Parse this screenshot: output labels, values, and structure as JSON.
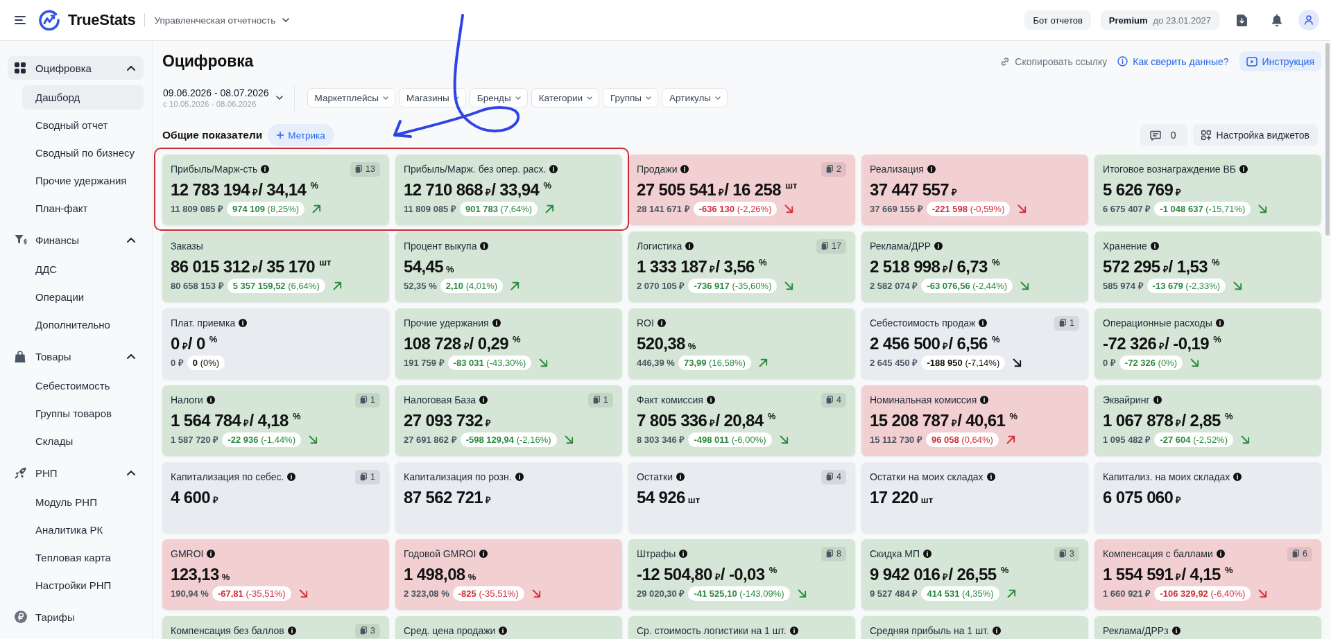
{
  "header": {
    "brand": "TrueStats",
    "workspace": "Управленческая отчетность",
    "bot_button": "Бот отчетов",
    "plan": {
      "name": "Premium",
      "until": "до 23.01.2027"
    }
  },
  "sidebar": {
    "items": [
      {
        "kind": "group",
        "label": "Оцифровка",
        "selected": true,
        "expanded": true,
        "children": [
          {
            "label": "Дашборд",
            "selected": true
          },
          {
            "label": "Сводный отчет",
            "selected": false
          },
          {
            "label": "Сводный по бизнесу",
            "selected": false
          },
          {
            "label": "Прочие удержания",
            "selected": false
          },
          {
            "label": "План-факт",
            "selected": false
          }
        ]
      },
      {
        "kind": "group",
        "label": "Финансы",
        "selected": false,
        "expanded": true,
        "children": [
          {
            "label": "ДДС",
            "selected": false
          },
          {
            "label": "Операции",
            "selected": false
          },
          {
            "label": "Дополнительно",
            "selected": false
          }
        ]
      },
      {
        "kind": "group",
        "label": "Товары",
        "selected": false,
        "expanded": true,
        "children": [
          {
            "label": "Себестоимость",
            "selected": false
          },
          {
            "label": "Группы товаров",
            "selected": false
          },
          {
            "label": "Склады",
            "selected": false
          }
        ]
      },
      {
        "kind": "group",
        "label": "РНП",
        "selected": false,
        "expanded": true,
        "children": [
          {
            "label": "Модуль РНП",
            "selected": false
          },
          {
            "label": "Аналитика РК",
            "selected": false
          },
          {
            "label": "Тепловая карта",
            "selected": false
          },
          {
            "label": "Настройки РНП",
            "selected": false
          }
        ]
      },
      {
        "kind": "link",
        "label": "Тарифы",
        "selected": false
      }
    ]
  },
  "page": {
    "title": "Оцифровка",
    "actions": [
      {
        "kind": "link",
        "label": "Скопировать ссылку"
      },
      {
        "kind": "help",
        "label": "Как сверить данные?"
      },
      {
        "kind": "video",
        "label": "Инструкция"
      }
    ]
  },
  "period": {
    "range": "09.06.2026 - 08.07.2026",
    "compare": "с 10.05.2026 - 08.06.2026"
  },
  "filters": [
    {
      "label": "Маркетплейсы"
    },
    {
      "label": "Магазины"
    },
    {
      "label": "Бренды"
    },
    {
      "label": "Категории"
    },
    {
      "label": "Группы"
    },
    {
      "label": "Артикулы"
    }
  ],
  "section": {
    "title": "Общие показатели",
    "add_button": "Метрика",
    "comments": "0",
    "settings_button": "Настройка виджетов"
  },
  "cards": [
    {
      "kind": "positive",
      "title": "Прибыль/Марж-сть",
      "info": true,
      "badge": "13",
      "amount": "12 783 194",
      "amount_unit": "₽",
      "ratio": "/ 34,14 $^{%}$",
      "previous": "11 809 085 ₽",
      "change": {
        "kind": "up",
        "text": "**974 109** (8,25%)"
      }
    },
    {
      "kind": "positive",
      "title": "Прибыль/Марж. без опер. расх.",
      "info": true,
      "amount": "12 710 868",
      "amount_unit": "₽",
      "ratio": "/ 33,94 $^{%}$",
      "previous": "11 809 085 ₽",
      "change": {
        "kind": "up",
        "text": "**901 783** (7,64%)"
      }
    },
    {
      "kind": "negative",
      "title": "Продажи",
      "info": true,
      "badge": "2",
      "amount": "27 505 541",
      "amount_unit": "₽",
      "ratio": "/ 16 258 $^{шт}$",
      "previous": "28 141 671 ₽",
      "change": {
        "kind": "down",
        "text": "**-636 130** (-2,26%)"
      }
    },
    {
      "kind": "negative",
      "title": "Реализация",
      "info": true,
      "amount": "37 447 557",
      "amount_unit": "₽",
      "previous": "37 669 155 ₽",
      "change": {
        "kind": "down",
        "text": "**-221 598** (-0,59%)"
      }
    },
    {
      "kind": "positive",
      "title": "Итоговое вознаграждение ВБ",
      "info": true,
      "amount": "5 626 769",
      "amount_unit": "₽",
      "previous": "6 675 407 ₽",
      "change": {
        "kind": "down",
        "text": "**-1 048 637** (-15,71%)"
      }
    },
    {
      "kind": "positive",
      "title": "Заказы",
      "info": false,
      "amount": "86 015 312",
      "amount_unit": "₽",
      "ratio": "/ 35 170 $^{шт}$",
      "previous": "80 658 153 ₽",
      "change": {
        "kind": "up",
        "text": "**5 357 159,52** (6,64%)"
      }
    },
    {
      "kind": "positive",
      "title": "Процент выкупа",
      "info": true,
      "amount": "54,45",
      "amount_unit": "%",
      "previous": "52,35 %",
      "change": {
        "kind": "up",
        "text": "**2,10** (4,01%)"
      }
    },
    {
      "kind": "positive",
      "title": "Логистика",
      "info": true,
      "badge": "17",
      "amount": "1 333 187",
      "amount_unit": "₽",
      "ratio": "/ 3,56 $^{%}$",
      "previous": "2 070 105 ₽",
      "change": {
        "kind": "down",
        "text": "**-736 917** (-35,60%)"
      }
    },
    {
      "kind": "positive",
      "title": "Реклама/ДРР",
      "info": true,
      "amount": "2 518 998",
      "amount_unit": "₽",
      "ratio": "/ 6,73 $^{%}$",
      "previous": "2 582 074 ₽",
      "change": {
        "kind": "down",
        "text": "**-63 076,56** (-2,44%)"
      }
    },
    {
      "kind": "positive",
      "title": "Хранение",
      "info": true,
      "amount": "572 295",
      "amount_unit": "₽",
      "ratio": "/ 1,53 $^{%}$",
      "previous": "585 974 ₽",
      "change": {
        "kind": "down",
        "text": "**-13 679** (-2,33%)"
      }
    },
    {
      "kind": "neutral",
      "title": "Плат. приемка",
      "info": true,
      "amount": "0",
      "amount_unit": "₽",
      "ratio": "/ 0 $^{%}$",
      "previous": "0 ₽",
      "change": {
        "kind": "flat",
        "text": "**0** (0%)"
      }
    },
    {
      "kind": "positive",
      "title": "Прочие удержания",
      "info": true,
      "amount": "108 728",
      "amount_unit": "₽",
      "ratio": "/ 0,29 $^{%}$",
      "previous": "191 759 ₽",
      "change": {
        "kind": "down",
        "text": "**-83 031** (-43,30%)"
      }
    },
    {
      "kind": "positive",
      "title": "ROI",
      "info": true,
      "amount": "520,38",
      "amount_unit": "%",
      "previous": "446,39 %",
      "change": {
        "kind": "up",
        "text": "**73,99** (16,58%)"
      }
    },
    {
      "kind": "neutral",
      "title": "Себестоимость продаж",
      "info": true,
      "badge": "1",
      "amount": "2 456 500",
      "amount_unit": "₽",
      "ratio": "/ 6,56 $^{%}$",
      "previous": "2 645 450 ₽",
      "change": {
        "kind": "down",
        "text": "**-188 950** (-7,14%)"
      }
    },
    {
      "kind": "positive",
      "title": "Операционные расходы",
      "info": true,
      "amount": "-72 326",
      "amount_unit": "₽",
      "ratio": "/ -0,19 $^{%}$",
      "previous": "0 ₽",
      "change": {
        "kind": "down",
        "text": "**-72 326** (0%)"
      }
    },
    {
      "kind": "positive",
      "title": "Налоги",
      "info": true,
      "badge": "1",
      "amount": "1 564 784",
      "amount_unit": "₽",
      "ratio": "/ 4,18 $^{%}$",
      "previous": "1 587 720 ₽",
      "change": {
        "kind": "down",
        "text": "**-22 936** (-1,44%)"
      }
    },
    {
      "kind": "positive",
      "title": "Налоговая База",
      "info": true,
      "badge": "1",
      "amount": "27 093 732",
      "amount_unit": "₽",
      "previous": "27 691 862 ₽",
      "change": {
        "kind": "down",
        "text": "**-598 129,94** (-2,16%)"
      }
    },
    {
      "kind": "positive",
      "title": "Факт комиссия",
      "info": true,
      "badge": "4",
      "amount": "7 805 336",
      "amount_unit": "₽",
      "ratio": "/ 20,84 $^{%}$",
      "previous": "8 303 346 ₽",
      "change": {
        "kind": "down",
        "text": "**-498 011** (-6,00%)"
      }
    },
    {
      "kind": "negative",
      "title": "Номинальная комиссия",
      "info": true,
      "amount": "15 208 787",
      "amount_unit": "₽",
      "ratio": "/ 40,61 $^{%}$",
      "previous": "15 112 730 ₽",
      "change": {
        "kind": "up",
        "text": "**96 058** (0,64%)"
      }
    },
    {
      "kind": "positive",
      "title": "Эквайринг",
      "info": true,
      "amount": "1 067 878",
      "amount_unit": "₽",
      "ratio": "/ 2,85 $^{%}$",
      "previous": "1 095 482 ₽",
      "change": {
        "kind": "down",
        "text": "**-27 604** (-2,52%)"
      }
    },
    {
      "kind": "neutral",
      "title": "Капитализация по себес.",
      "info": true,
      "badge": "1",
      "amount": "4 600",
      "amount_unit": "₽"
    },
    {
      "kind": "neutral",
      "title": "Капитализация по розн.",
      "info": true,
      "amount": "87 562 721",
      "amount_unit": "₽"
    },
    {
      "kind": "neutral",
      "title": "Остатки",
      "info": true,
      "badge": "4",
      "amount": "54 926",
      "amount_unit": "шт"
    },
    {
      "kind": "neutral",
      "title": "Остатки на моих складах",
      "info": true,
      "amount": "17 220",
      "amount_unit": "шт"
    },
    {
      "kind": "neutral",
      "title": "Капитализ. на моих складах",
      "info": true,
      "amount": "6 075 060",
      "amount_unit": "₽"
    },
    {
      "kind": "negative",
      "title": "GMROI",
      "info": true,
      "amount": "123,13",
      "amount_unit": "%",
      "previous": "190,94 %",
      "change": {
        "kind": "down",
        "text": "**-67,81** (-35,51%)"
      }
    },
    {
      "kind": "negative",
      "title": "Годовой GMROI",
      "info": true,
      "amount": "1 498,08",
      "amount_unit": "%",
      "previous": "2 323,08 %",
      "change": {
        "kind": "down",
        "text": "**-825** (-35,51%)"
      }
    },
    {
      "kind": "positive",
      "title": "Штрафы",
      "info": true,
      "badge": "8",
      "amount": "-12 504,80",
      "amount_unit": "₽",
      "ratio": "/ -0,03 $^{%}$",
      "previous": "29 020,30 ₽",
      "change": {
        "kind": "down",
        "text": "**-41 525,10** (-143,09%)"
      }
    },
    {
      "kind": "positive",
      "title": "Скидка МП",
      "info": true,
      "badge": "3",
      "amount": "9 942 016",
      "amount_unit": "₽",
      "ratio": "/ 26,55 $^{%}$",
      "previous": "9 527 484 ₽",
      "change": {
        "kind": "up",
        "text": "**414 531** (4,35%)"
      }
    },
    {
      "kind": "negative",
      "title": "Компенсация с баллами",
      "info": true,
      "badge": "6",
      "amount": "1 554 591",
      "amount_unit": "₽",
      "ratio": "/ 4,15 $^{%}$",
      "previous": "1 660 921 ₽",
      "change": {
        "kind": "down",
        "text": "**-106 329,92** (-6,40%)"
      }
    },
    {
      "kind": "positive",
      "title": "Компенсация без баллов",
      "info": true,
      "badge": "3"
    },
    {
      "kind": "positive",
      "title": "Сред. цена продажи",
      "info": true
    },
    {
      "kind": "positive",
      "title": "Ср. стоимость логистики на 1 шт.",
      "info": true
    },
    {
      "kind": "positive",
      "title": "Средняя прибыль на 1 шт.",
      "info": true
    },
    {
      "kind": "positive",
      "title": "Реклама/ДРРз",
      "info": true
    }
  ]
}
